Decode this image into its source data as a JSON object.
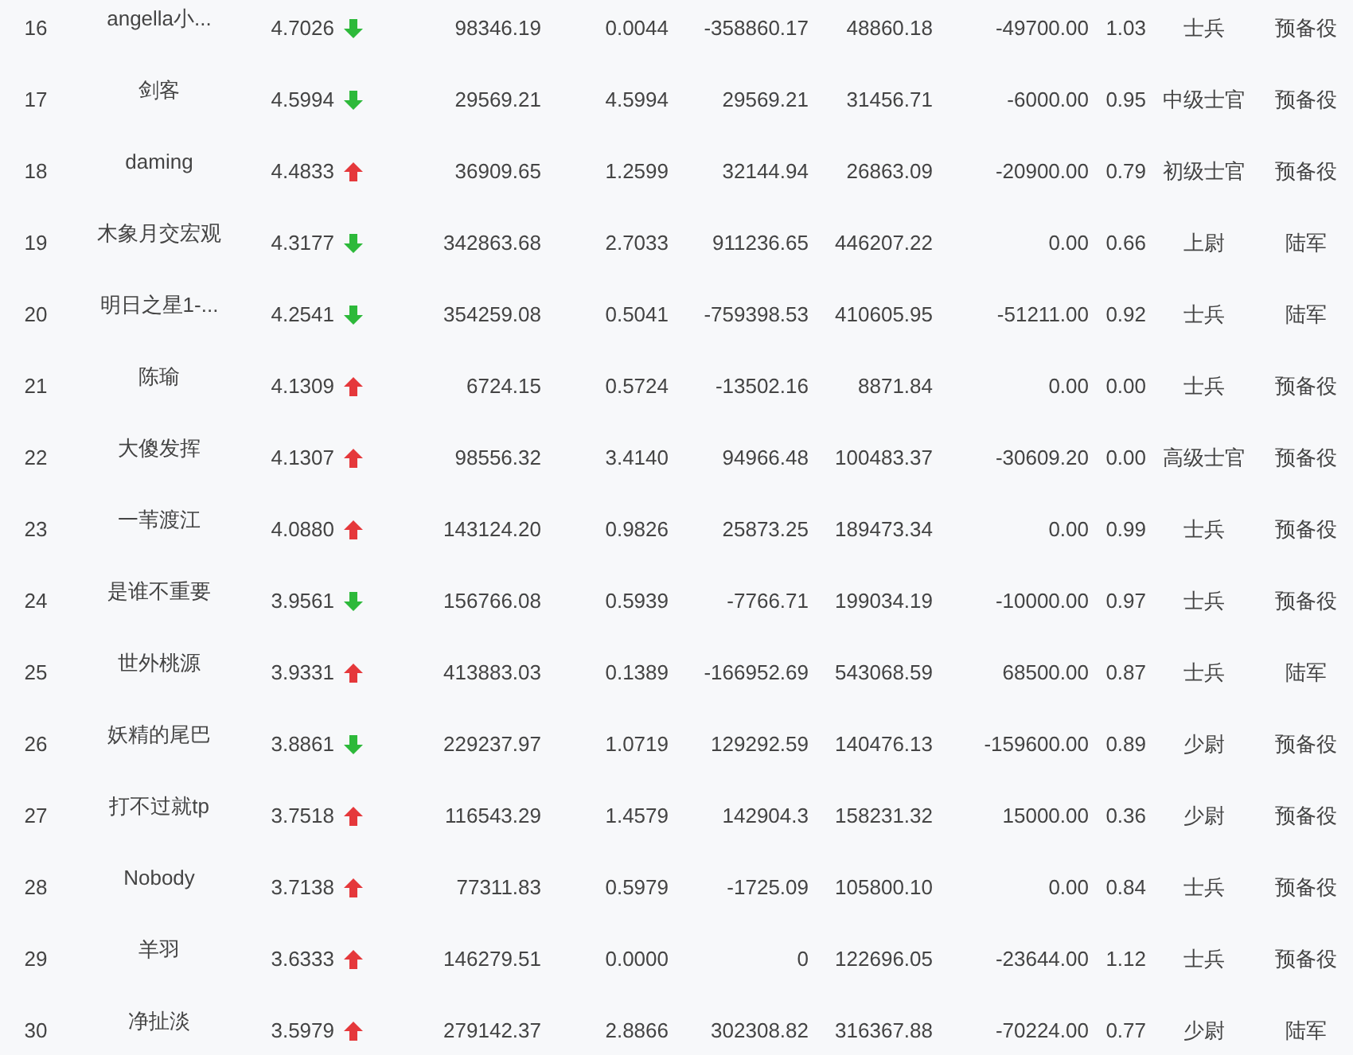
{
  "table": {
    "rows": [
      {
        "rank": "16",
        "name": "angella小...",
        "score": "4.7026",
        "rising": false,
        "cells": [
          "98346.19",
          "0.0044",
          "-358860.17",
          "48860.18",
          "-49700.00",
          "1.03",
          "士兵",
          "预备役"
        ]
      },
      {
        "rank": "17",
        "name": "剑客",
        "score": "4.5994",
        "rising": false,
        "cells": [
          "29569.21",
          "4.5994",
          "29569.21",
          "31456.71",
          "-6000.00",
          "0.95",
          "中级士官",
          "预备役"
        ]
      },
      {
        "rank": "18",
        "name": "daming",
        "score": "4.4833",
        "rising": true,
        "cells": [
          "36909.65",
          "1.2599",
          "32144.94",
          "26863.09",
          "-20900.00",
          "0.79",
          "初级士官",
          "预备役"
        ]
      },
      {
        "rank": "19",
        "name": "木象月交宏观",
        "score": "4.3177",
        "rising": false,
        "cells": [
          "342863.68",
          "2.7033",
          "911236.65",
          "446207.22",
          "0.00",
          "0.66",
          "上尉",
          "陆军"
        ]
      },
      {
        "rank": "20",
        "name": "明日之星1-...",
        "score": "4.2541",
        "rising": false,
        "cells": [
          "354259.08",
          "0.5041",
          "-759398.53",
          "410605.95",
          "-51211.00",
          "0.92",
          "士兵",
          "陆军"
        ]
      },
      {
        "rank": "21",
        "name": "陈瑜",
        "score": "4.1309",
        "rising": true,
        "cells": [
          "6724.15",
          "0.5724",
          "-13502.16",
          "8871.84",
          "0.00",
          "0.00",
          "士兵",
          "预备役"
        ]
      },
      {
        "rank": "22",
        "name": "大傻发挥",
        "score": "4.1307",
        "rising": true,
        "cells": [
          "98556.32",
          "3.4140",
          "94966.48",
          "100483.37",
          "-30609.20",
          "0.00",
          "高级士官",
          "预备役"
        ]
      },
      {
        "rank": "23",
        "name": "一苇渡江",
        "score": "4.0880",
        "rising": true,
        "cells": [
          "143124.20",
          "0.9826",
          "25873.25",
          "189473.34",
          "0.00",
          "0.99",
          "士兵",
          "预备役"
        ]
      },
      {
        "rank": "24",
        "name": "是谁不重要",
        "score": "3.9561",
        "rising": false,
        "cells": [
          "156766.08",
          "0.5939",
          "-7766.71",
          "199034.19",
          "-10000.00",
          "0.97",
          "士兵",
          "预备役"
        ]
      },
      {
        "rank": "25",
        "name": "世外桃源",
        "score": "3.9331",
        "rising": true,
        "cells": [
          "413883.03",
          "0.1389",
          "-166952.69",
          "543068.59",
          "68500.00",
          "0.87",
          "士兵",
          "陆军"
        ]
      },
      {
        "rank": "26",
        "name": "妖精的尾巴",
        "score": "3.8861",
        "rising": false,
        "cells": [
          "229237.97",
          "1.0719",
          "129292.59",
          "140476.13",
          "-159600.00",
          "0.89",
          "少尉",
          "预备役"
        ]
      },
      {
        "rank": "27",
        "name": "打不过就tp",
        "score": "3.7518",
        "rising": true,
        "cells": [
          "116543.29",
          "1.4579",
          "142904.3",
          "158231.32",
          "15000.00",
          "0.36",
          "少尉",
          "预备役"
        ]
      },
      {
        "rank": "28",
        "name": "Nobody",
        "score": "3.7138",
        "rising": true,
        "cells": [
          "77311.83",
          "0.5979",
          "-1725.09",
          "105800.10",
          "0.00",
          "0.84",
          "士兵",
          "预备役"
        ]
      },
      {
        "rank": "29",
        "name": "羊羽",
        "score": "3.6333",
        "rising": true,
        "cells": [
          "146279.51",
          "0.0000",
          "0",
          "122696.05",
          "-23644.00",
          "1.12",
          "士兵",
          "预备役"
        ]
      },
      {
        "rank": "30",
        "name": "净扯淡",
        "score": "3.5979",
        "rising": true,
        "cells": [
          "279142.37",
          "2.8866",
          "302308.82",
          "316367.88",
          "-70224.00",
          "0.77",
          "少尉",
          "陆军"
        ]
      }
    ]
  }
}
